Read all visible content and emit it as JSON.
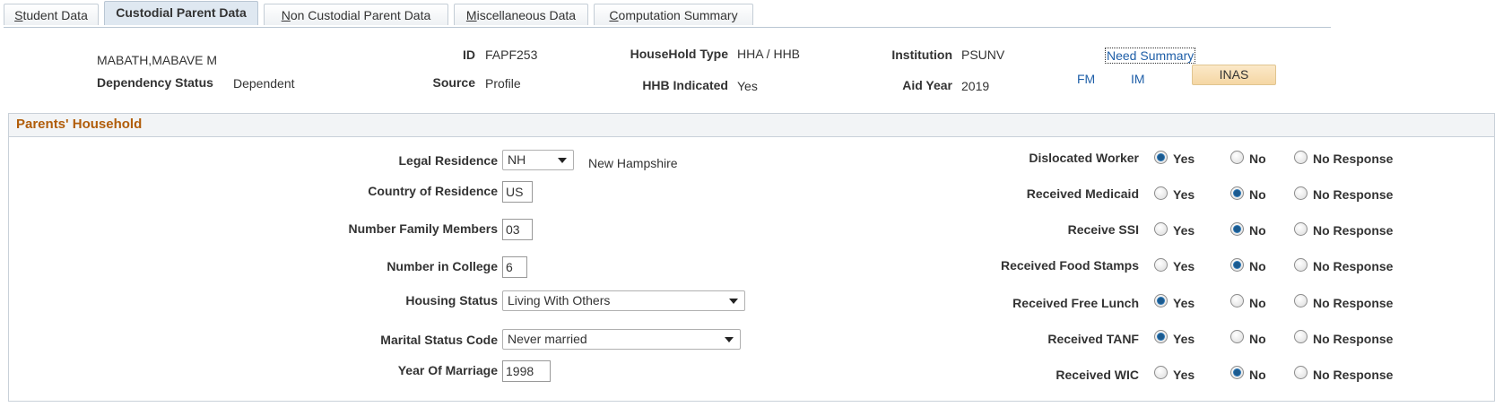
{
  "tabs": [
    {
      "prefix": "",
      "accel": "S",
      "rest": "tudent Data"
    },
    {
      "prefix": "Custodial Parent Data",
      "accel": "",
      "rest": ""
    },
    {
      "prefix": "",
      "accel": "N",
      "rest": "on Custodial Parent Data"
    },
    {
      "prefix": "",
      "accel": "M",
      "rest": "iscellaneous Data"
    },
    {
      "prefix": "",
      "accel": "C",
      "rest": "omputation Summary"
    }
  ],
  "header": {
    "student_name": "MABATH,MABAVE M",
    "dependency_label": "Dependency Status",
    "dependency_value": "Dependent",
    "id_label": "ID",
    "id_value": "FAPF253",
    "source_label": "Source",
    "source_value": "Profile",
    "household_type_label": "HouseHold Type",
    "household_type_value": "HHA / HHB",
    "hhb_label": "HHB Indicated",
    "hhb_value": "Yes",
    "institution_label": "Institution",
    "institution_value": "PSUNV",
    "aid_year_label": "Aid Year",
    "aid_year_value": "2019",
    "need_summary_link": "Need Summary",
    "fm_link": "FM",
    "im_link": "IM",
    "inas_button": "INAS"
  },
  "household": {
    "title": "Parents' Household",
    "legal_residence_label": "Legal Residence",
    "legal_residence_value": "NH",
    "legal_residence_desc": "New Hampshire",
    "country_label": "Country of Residence",
    "country_value": "US",
    "family_members_label": "Number Family Members",
    "family_members_value": "03",
    "in_college_label": "Number in College",
    "in_college_value": "6",
    "housing_label": "Housing Status",
    "housing_value": "Living With Others",
    "marital_label": "Marital Status Code",
    "marital_value": "Never married",
    "marriage_year_label": "Year Of Marriage",
    "marriage_year_value": "1998"
  },
  "radio_options": {
    "yes": "Yes",
    "no": "No",
    "none": "No Response"
  },
  "benefits": [
    {
      "label": "Dislocated Worker",
      "selected": "yes"
    },
    {
      "label": "Received Medicaid",
      "selected": "no"
    },
    {
      "label": "Receive SSI",
      "selected": "no"
    },
    {
      "label": "Received Food Stamps",
      "selected": "no"
    },
    {
      "label": "Received Free Lunch",
      "selected": "yes"
    },
    {
      "label": "Received TANF",
      "selected": "yes"
    },
    {
      "label": "Received WIC",
      "selected": "no"
    }
  ],
  "colors": {
    "link": "#1f5fa8",
    "group_title": "#b15d0a",
    "radio_selected": "#1c5a8e"
  }
}
